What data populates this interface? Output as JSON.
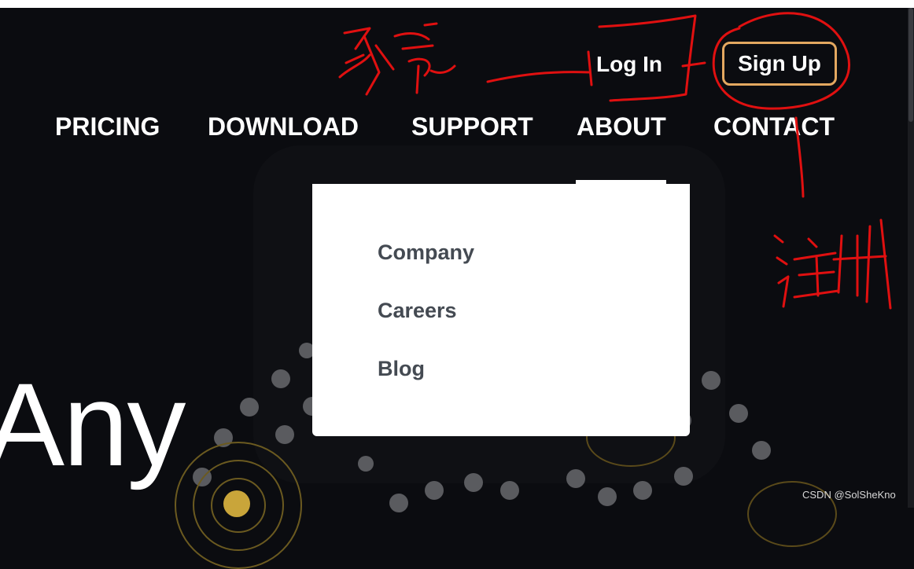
{
  "auth": {
    "login_label": "Log In",
    "signup_label": "Sign Up",
    "signup_border_color": "#e3a860"
  },
  "nav": {
    "items": [
      {
        "label": "PRICING"
      },
      {
        "label": "DOWNLOAD"
      },
      {
        "label": "SUPPORT"
      },
      {
        "label": "ABOUT",
        "active": true
      },
      {
        "label": "CONTACT"
      }
    ]
  },
  "dropdown": {
    "items": [
      {
        "label": "Company"
      },
      {
        "label": "Careers"
      },
      {
        "label": "Blog"
      }
    ]
  },
  "hero": {
    "word": "Any"
  },
  "watermark": "CSDN @SolSheKno",
  "annotations": {
    "login_handwriting": "登录",
    "signup_handwriting": "注册",
    "ink_color": "#e01010"
  },
  "colors": {
    "background": "#0b0c10",
    "dropdown_text": "#444a52"
  }
}
